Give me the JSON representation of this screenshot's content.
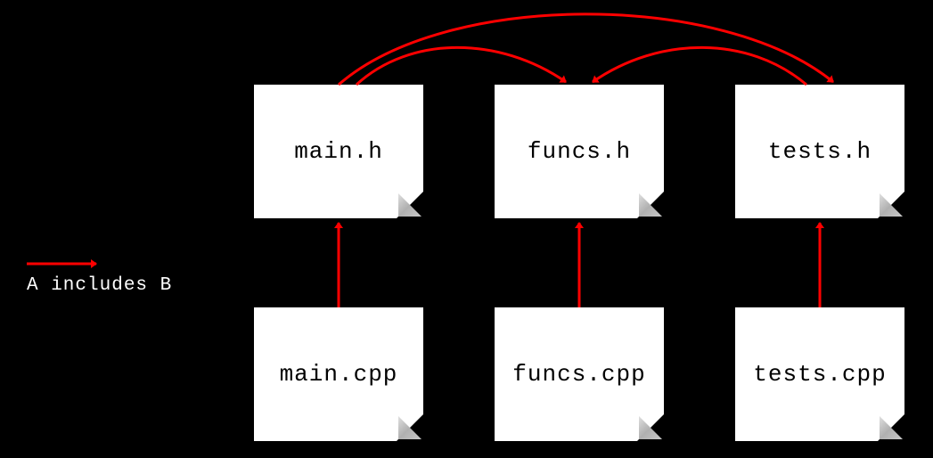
{
  "diagram": {
    "legend": {
      "text_line1": "A includes B",
      "direction_hint": "A → B"
    },
    "files": {
      "main_h": "main.h",
      "funcs_h": "funcs.h",
      "tests_h": "tests.h",
      "main_cpp": "main.cpp",
      "funcs_cpp": "funcs.cpp",
      "tests_cpp": "tests.cpp"
    },
    "includes": [
      {
        "from": "main.cpp",
        "to": "main.h"
      },
      {
        "from": "funcs.cpp",
        "to": "funcs.h"
      },
      {
        "from": "tests.cpp",
        "to": "tests.h"
      },
      {
        "from": "main.h",
        "to": "funcs.h"
      },
      {
        "from": "main.h",
        "to": "tests.h"
      },
      {
        "from": "tests.h",
        "to": "funcs.h"
      }
    ],
    "colors": {
      "arrow": "#ff0000",
      "background": "#000000",
      "box": "#ffffff",
      "text_on_dark": "#ffffff",
      "text_on_light": "#000000"
    }
  }
}
